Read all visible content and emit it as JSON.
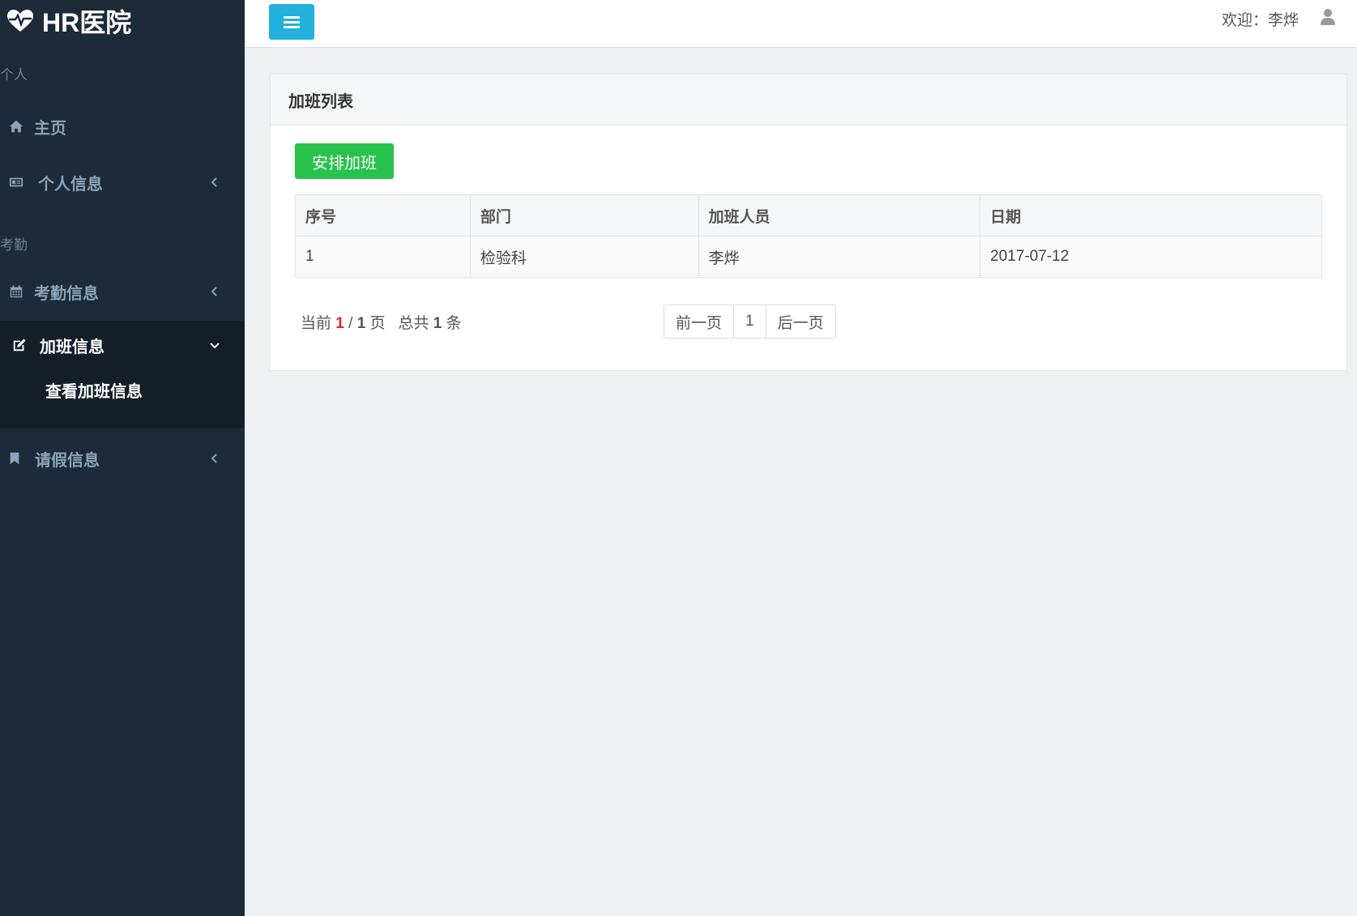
{
  "app": {
    "title": "HR医院"
  },
  "sidebar": {
    "sections": [
      "个人",
      "考勤"
    ],
    "items": [
      {
        "label": "主页",
        "icon": "home-icon"
      },
      {
        "label": "个人信息",
        "icon": "id-card-icon"
      },
      {
        "label": "考勤信息",
        "icon": "calendar-icon"
      },
      {
        "label": "加班信息",
        "icon": "edit-icon"
      },
      {
        "label": "请假信息",
        "icon": "bookmark-icon"
      }
    ],
    "sub_item": "查看加班信息"
  },
  "topbar": {
    "welcome": "欢迎：李烨",
    "user_icon": "user-icon",
    "menu_icon": "menu-bars-icon"
  },
  "panel": {
    "title": "加班列表",
    "add_button": "安排加班"
  },
  "table": {
    "columns": [
      "序号",
      "部门",
      "加班人员",
      "日期"
    ],
    "rows": [
      [
        "1",
        "检验科",
        "李烨",
        "2017-07-12"
      ]
    ]
  },
  "pagination": {
    "prefix": "当前",
    "current": "1",
    "sep": "/",
    "total_pages": "1",
    "page_unit": "页",
    "total_prefix": "总共",
    "total_items": "1",
    "item_unit": "条",
    "prev": "前一页",
    "page": "1",
    "next": "后一页"
  },
  "colors": {
    "sidebar_bg": "#1d2a37",
    "accent_blue": "#22b0dc",
    "success_green": "#27c24c",
    "current_page_red": "#e02424"
  }
}
